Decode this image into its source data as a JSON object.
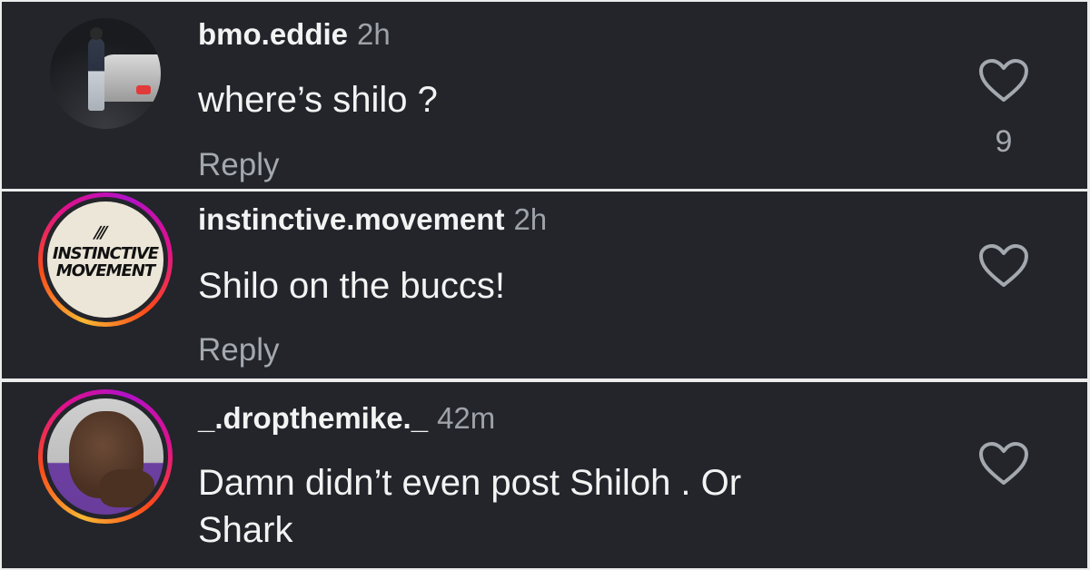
{
  "comments": [
    {
      "username": "bmo.eddie",
      "time": "2h",
      "text": "where’s shilo ?",
      "reply_label": "Reply",
      "likes": "9",
      "avatar": "photo-car"
    },
    {
      "username": "instinctive.movement",
      "time": "2h",
      "text": "Shilo on the buccs!",
      "reply_label": "Reply",
      "avatar": "logo",
      "logo_marks": "///",
      "logo_line1": "INSTINCTIVE",
      "logo_line2": "MOVEMENT"
    },
    {
      "username": "_.dropthemike._",
      "time": "42m",
      "text_line1": "Damn didn’t even post Shiloh . Or",
      "text_line2": "Shark",
      "avatar": "photo-face"
    }
  ],
  "colors": {
    "background": "#23252b",
    "primary_text": "#f3f3f3",
    "secondary_text": "#9ea2a9",
    "story_ring": [
      "#f7b733",
      "#fc4a1a",
      "#e0118b",
      "#b111c9"
    ]
  },
  "icons": {
    "like": "heart-outline-icon"
  }
}
